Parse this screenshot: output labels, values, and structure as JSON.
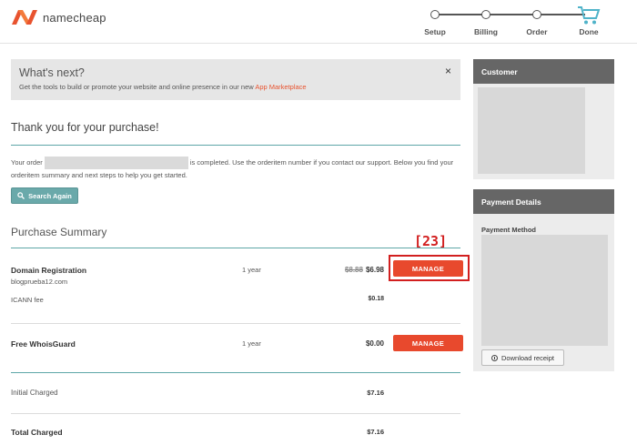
{
  "header": {
    "logo_text": "namecheap",
    "steps": [
      {
        "label": "Setup"
      },
      {
        "label": "Billing"
      },
      {
        "label": "Order"
      },
      {
        "label": "Done"
      }
    ]
  },
  "whats_next": {
    "title": "What's next?",
    "text": "Get the tools to build or promote your website and online presence in our new",
    "link": "App Marketplace",
    "close": "×"
  },
  "thanks": "Thank you for your purchase!",
  "order": {
    "before": "Your order",
    "after": "is completed. Use the orderitem number if you contact our support. Below you find your orderitem summary and next steps to help you get started."
  },
  "search_again": "Search Again",
  "summary": {
    "title": "Purchase Summary",
    "annotation": "[23]",
    "manage_label": "MANAGE",
    "domain": {
      "label": "Domain Registration",
      "domain_name": "blogprueba12.com",
      "period": "1 year",
      "old_price": "$8.88",
      "price": "$6.98"
    },
    "icann": {
      "label": "ICANN fee",
      "price": "$0.18"
    },
    "whoisguard": {
      "label": "Free WhoisGuard",
      "period": "1 year",
      "price": "$0.00"
    },
    "initial": {
      "label": "Initial Charged",
      "price": "$7.16"
    },
    "total": {
      "label": "Total Charged",
      "price": "$7.16"
    }
  },
  "customer": {
    "title": "Customer"
  },
  "payment": {
    "title": "Payment Details",
    "method_label": "Payment Method",
    "download": "Download receipt"
  },
  "colors": {
    "accent": "#e8492d",
    "teal": "#5da6a7",
    "panel_head": "#666666"
  }
}
